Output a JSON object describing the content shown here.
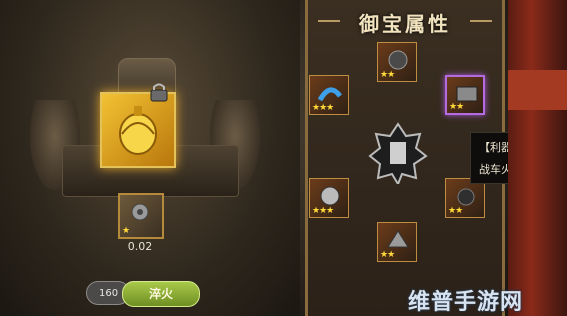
{
  "panel": {
    "title": "御宝属性"
  },
  "left": {
    "small_slot_value": "0.02",
    "smelt_count": "160",
    "smelt_button_label": "淬火"
  },
  "slots": [
    {
      "id": "top",
      "stars": "★★"
    },
    {
      "id": "upper-left",
      "stars": "★★★"
    },
    {
      "id": "upper-right",
      "stars": "★★",
      "selected": true
    },
    {
      "id": "lower-left",
      "stars": "★★★"
    },
    {
      "id": "lower-right",
      "stars": "★★"
    },
    {
      "id": "bottom",
      "stars": "★★"
    }
  ],
  "tooltip": {
    "title": "【利器】",
    "description": "战车火力提升"
  },
  "watermark": "维普手游网",
  "colors": {
    "gold": "#e3c25c",
    "selected_purple": "#b46ae0",
    "button_green": "#8fb23a"
  },
  "icons": [
    "lock-icon",
    "bell-icon",
    "gear-icon",
    "emblem-icon"
  ]
}
